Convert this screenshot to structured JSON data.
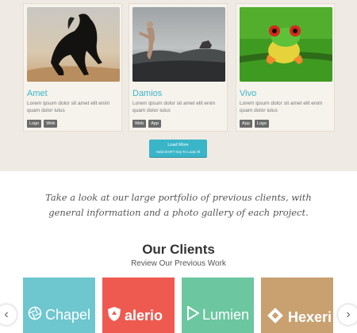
{
  "portfolio": {
    "items": [
      {
        "title": "Amet",
        "desc": "Lorem ipsum dolor sit amet elit enim quam dolor iulus",
        "tags": [
          "Logo",
          "Web"
        ]
      },
      {
        "title": "Damios",
        "desc": "Lorem ipsum dolor sit amet elit enim quam dolor iulus",
        "tags": [
          "Web",
          "App"
        ]
      },
      {
        "title": "Vivo",
        "desc": "Lorem ipsum dolor sit amet elit enim quam dolor iulus",
        "tags": [
          "App",
          "Logo"
        ]
      }
    ],
    "load_more": {
      "label": "Load More",
      "hint": "Hold SHIFT Key To Load All"
    }
  },
  "tagline": "Take a look at our large portfolio of previous clients, with general information and a photo gallery of each project.",
  "clients": {
    "title": "Our Clients",
    "subtitle": "Review Our Previous Work",
    "logos": [
      {
        "name": "Chapel",
        "icon": "aperture-icon",
        "color": "#6ec6cf"
      },
      {
        "name": "alerio",
        "icon": "shield-icon",
        "color": "#ee5a50"
      },
      {
        "name": "Lumien",
        "icon": "play-icon",
        "color": "#6cc7a0"
      },
      {
        "name": "Hexeri",
        "icon": "diamond-icon",
        "color": "#c9a070"
      }
    ]
  },
  "carousel": {
    "prev": "‹",
    "next": "›"
  }
}
